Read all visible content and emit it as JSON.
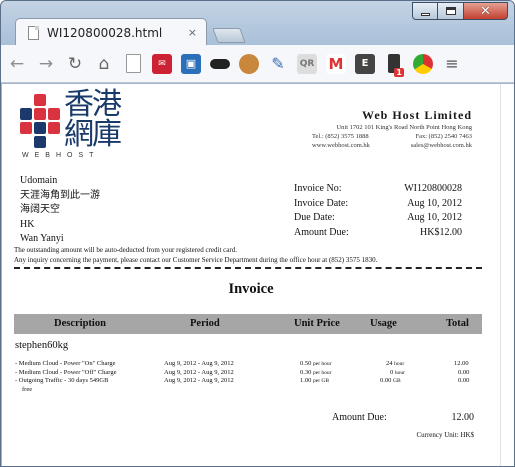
{
  "browser": {
    "tab_title": "WI120800028.html",
    "tab_close": "×"
  },
  "toolbar": {
    "icons": [
      "back-icon",
      "forward-icon",
      "reload-icon",
      "home-icon",
      "page-icon",
      "extension-icon",
      "screenshot-icon",
      "incognito-mask-icon",
      "cookie-icon",
      "eyedropper-icon",
      "qr-icon",
      "gmail-icon",
      "evernote-icon",
      "phone-icon",
      "chrome-store-icon",
      "menu-icon"
    ],
    "phone_badge": "1"
  },
  "logo": {
    "chinese": "香港網庫",
    "wordmark": "WEBHOST"
  },
  "company": {
    "name": "Web Host Limited",
    "address": "Unit 1702 101 King's Road North Point Hong Kong",
    "tel": "Tel.: (852) 3575 1888",
    "fax": "Fax: (852) 2540 7463",
    "web": "www.webhost.com.hk",
    "email": "sales@webhost.com.hk"
  },
  "customer_address": {
    "line1": "Udomain",
    "line2": "天涯海角到此一游",
    "line3": "海阔天空",
    "line4": "HK",
    "line5": "Wan Yanyi"
  },
  "invoice_meta": {
    "no_label": "Invoice No:",
    "no_value": "WI120800028",
    "date_label": "Invoice Date:",
    "date_value": "Aug 10, 2012",
    "due_label": "Due Date:",
    "due_value": "Aug 10, 2012",
    "amount_label": "Amount Due:",
    "amount_value": "HK$12.00"
  },
  "notes": {
    "line1": "The outstanding amount will be auto-deducted from your registered credit card.",
    "line2": "Any inquiry concerning the payment, please contact our Customer Service Department during the office hour at (852) 3575 1830."
  },
  "invoice": {
    "title": "Invoice",
    "columns": {
      "description": "Description",
      "period": "Period",
      "unit_price": "Unit Price",
      "usage": "Usage",
      "total": "Total"
    },
    "customer_id": "stephen60kg",
    "items": [
      {
        "desc": "-  Medium Cloud - Power \"On\" Charge",
        "period": "Aug 9, 2012 - Aug 9, 2012",
        "price": "0.50",
        "price_unit": "per hour",
        "usage": "24",
        "usage_unit": "hour",
        "total": "12.00"
      },
      {
        "desc": "-  Medium Cloud - Power \"Off\" Charge",
        "period": "Aug 9, 2012 - Aug 9, 2012",
        "price": "0.30",
        "price_unit": "per hour",
        "usage": "0",
        "usage_unit": "hour",
        "total": "0.00"
      },
      {
        "desc": "-  Outgoing Traffic - 30 days 549GB",
        "period": "Aug 9, 2012 - Aug 9, 2012",
        "price": "1.00",
        "price_unit": "per GB",
        "usage": "0.00",
        "usage_unit": "GB",
        "total": "0.00"
      }
    ],
    "item3_cont": "free",
    "amount_due_label": "Amount Due:",
    "amount_due_value": "12.00",
    "currency_unit": "Currency Unit: HK$"
  },
  "colors": {
    "logo_red": "#d9333f",
    "logo_navy": "#1b3a6b",
    "table_header": "#a6a6a6"
  }
}
